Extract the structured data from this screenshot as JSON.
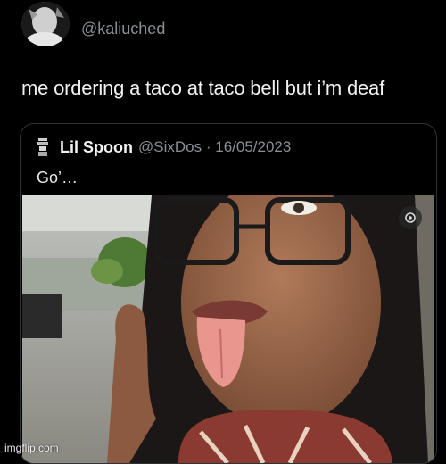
{
  "tweet": {
    "handle": "@kaliuched",
    "text": "me ordering a taco at taco bell but i’m deaf"
  },
  "quote": {
    "name": "Lil Spoon",
    "handle": "@SixDos",
    "separator": "·",
    "date": "16/05/2023",
    "text": "Go’…"
  },
  "media": {
    "badge_icon": "media-settings-icon"
  },
  "watermark": "imgflip.com",
  "colors": {
    "background": "#000000",
    "text": "#e7e9ea",
    "secondary_text": "#8b8f94",
    "border": "#2f3336"
  }
}
